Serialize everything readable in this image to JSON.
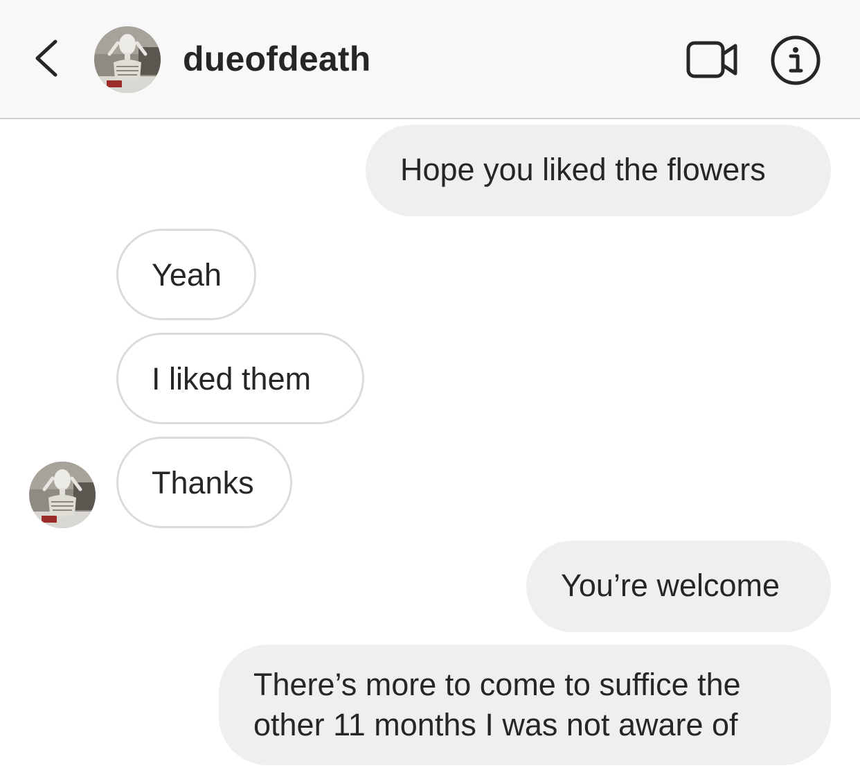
{
  "header": {
    "username": "dueofdeath",
    "back_icon": "chevron-left-icon",
    "video_icon": "video-camera-icon",
    "info_icon": "info-icon"
  },
  "messages": [
    {
      "direction": "sent",
      "text": "Hope you liked the flowers"
    },
    {
      "direction": "received",
      "text": "Yeah"
    },
    {
      "direction": "received",
      "text": "I liked them"
    },
    {
      "direction": "received",
      "text": "Thanks"
    },
    {
      "direction": "sent",
      "text": "You’re welcome"
    },
    {
      "direction": "sent",
      "lines": [
        "There’s more to come to suffice the",
        "other 11 months I was not aware of"
      ]
    }
  ],
  "colors": {
    "header_bg": "#f8f8f8",
    "sent_bubble": "#efefef",
    "received_border": "#dbdbdb",
    "text": "#262626"
  }
}
